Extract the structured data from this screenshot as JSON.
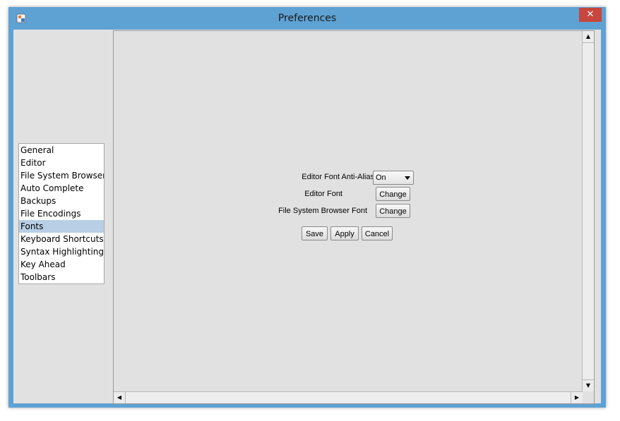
{
  "window": {
    "title": "Preferences",
    "close_glyph": "✕"
  },
  "sidebar": {
    "selected_index": 6,
    "items": [
      {
        "label": "General"
      },
      {
        "label": "Editor"
      },
      {
        "label": "File System Browser"
      },
      {
        "label": "Auto Complete"
      },
      {
        "label": "Backups"
      },
      {
        "label": "File Encodings"
      },
      {
        "label": "Fonts"
      },
      {
        "label": "Keyboard Shortcuts"
      },
      {
        "label": "Syntax Highlighting"
      },
      {
        "label": "Key Ahead"
      },
      {
        "label": "Toolbars"
      }
    ]
  },
  "fonts_panel": {
    "anti_alias_label": "Editor Font Anti-Alias",
    "anti_alias_value": "On",
    "editor_font_label": "Editor Font",
    "editor_font_button": "Change",
    "fs_browser_font_label": "File System Browser Font",
    "fs_browser_font_button": "Change"
  },
  "actions": {
    "save": "Save",
    "apply": "Apply",
    "cancel": "Cancel"
  },
  "scroll": {
    "up": "▲",
    "down": "▼",
    "left": "◀",
    "right": "▶"
  },
  "icons": {
    "app": "app-icon",
    "close": "close-icon"
  },
  "colors": {
    "title_bar": "#5ea2d4",
    "close_button": "#c7463d",
    "selection": "#b8cfe5"
  }
}
